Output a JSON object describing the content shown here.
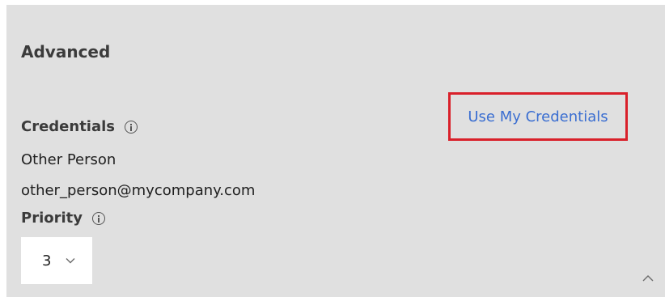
{
  "section": {
    "title": "Advanced"
  },
  "credentials": {
    "label": "Credentials",
    "name": "Other Person",
    "email": "other_person@mycompany.com",
    "use_my_credentials_label": "Use My Credentials"
  },
  "priority": {
    "label": "Priority",
    "selected_value": "3"
  },
  "icons": {
    "credentials_info": "info-icon",
    "priority_info": "info-icon",
    "dropdown": "chevron-down-icon",
    "collapse": "chevron-up-icon"
  },
  "colors": {
    "panel_background": "#e0e0e0",
    "link_blue": "#3a6ed1",
    "highlight_red": "#d9202a"
  }
}
